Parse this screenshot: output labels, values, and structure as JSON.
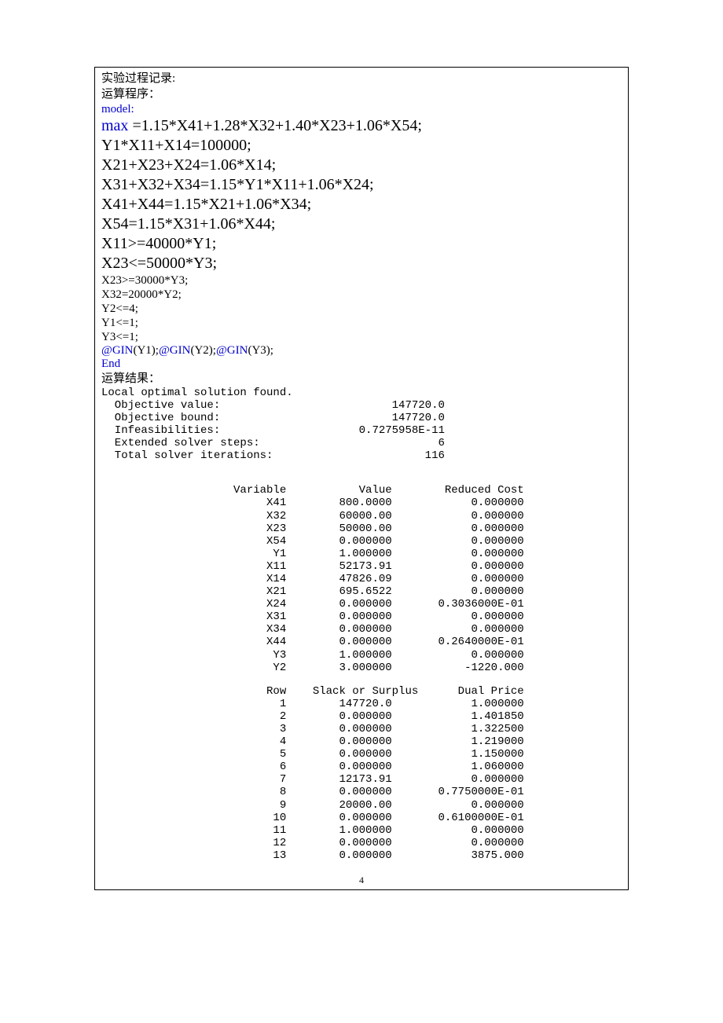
{
  "header": {
    "title": "实验过程记录:",
    "subtitle": "运算程序：",
    "model_kw": "model:"
  },
  "equations": {
    "max_label": "max",
    "max_rest": " =1.15*X41+1.28*X32+1.40*X23+1.06*X54;",
    "eq1": "Y1*X11+X14=100000;",
    "eq2": "X21+X23+X24=1.06*X14;",
    "eq3": "X31+X32+X34=1.15*Y1*X11+1.06*X24;",
    "eq4": "X41+X44=1.15*X21+1.06*X34;",
    "eq5": "X54=1.15*X31+1.06*X44;",
    "eq6": "X11>=40000*Y1;",
    "eq7": "X23<=50000*Y3;",
    "s1": "X23>=30000*Y3;",
    "s2": "X32=20000*Y2;",
    "s3": "Y2<=4;",
    "s4": "Y1<=1;",
    "s5": "Y3<=1;",
    "gin1": "@GIN",
    "gin1a": "(Y1);",
    "gin2": "@GIN",
    "gin2a": "(Y2);",
    "gin3": "@GIN",
    "gin3a": "(Y3);",
    "end": "End"
  },
  "results": {
    "title": "运算结果：",
    "status": "Local optimal solution found.",
    "summary": [
      {
        "label": "Objective value:",
        "value": "147720.0"
      },
      {
        "label": "Objective bound:",
        "value": "147720.0"
      },
      {
        "label": "Infeasibilities:",
        "value": "0.7275958E-11"
      },
      {
        "label": "Extended solver steps:",
        "value": "6"
      },
      {
        "label": "Total solver iterations:",
        "value": "116"
      }
    ],
    "var_header": {
      "c1": "Variable",
      "c2": "Value",
      "c3": "Reduced Cost"
    },
    "variables": [
      {
        "name": "X41",
        "value": "800.0000",
        "rc": "0.000000"
      },
      {
        "name": "X32",
        "value": "60000.00",
        "rc": "0.000000"
      },
      {
        "name": "X23",
        "value": "50000.00",
        "rc": "0.000000"
      },
      {
        "name": "X54",
        "value": "0.000000",
        "rc": "0.000000"
      },
      {
        "name": "Y1",
        "value": "1.000000",
        "rc": "0.000000"
      },
      {
        "name": "X11",
        "value": "52173.91",
        "rc": "0.000000"
      },
      {
        "name": "X14",
        "value": "47826.09",
        "rc": "0.000000"
      },
      {
        "name": "X21",
        "value": "695.6522",
        "rc": "0.000000"
      },
      {
        "name": "X24",
        "value": "0.000000",
        "rc": "0.3036000E-01"
      },
      {
        "name": "X31",
        "value": "0.000000",
        "rc": "0.000000"
      },
      {
        "name": "X34",
        "value": "0.000000",
        "rc": "0.000000"
      },
      {
        "name": "X44",
        "value": "0.000000",
        "rc": "0.2640000E-01"
      },
      {
        "name": "Y3",
        "value": "1.000000",
        "rc": "0.000000"
      },
      {
        "name": "Y2",
        "value": "3.000000",
        "rc": "-1220.000"
      }
    ],
    "row_header": {
      "c1": "Row",
      "c2": "Slack or Surplus",
      "c3": "Dual Price"
    },
    "rows": [
      {
        "row": "1",
        "slack": "147720.0",
        "dp": "1.000000"
      },
      {
        "row": "2",
        "slack": "0.000000",
        "dp": "1.401850"
      },
      {
        "row": "3",
        "slack": "0.000000",
        "dp": "1.322500"
      },
      {
        "row": "4",
        "slack": "0.000000",
        "dp": "1.219000"
      },
      {
        "row": "5",
        "slack": "0.000000",
        "dp": "1.150000"
      },
      {
        "row": "6",
        "slack": "0.000000",
        "dp": "1.060000"
      },
      {
        "row": "7",
        "slack": "12173.91",
        "dp": "0.000000"
      },
      {
        "row": "8",
        "slack": "0.000000",
        "dp": "0.7750000E-01"
      },
      {
        "row": "9",
        "slack": "20000.00",
        "dp": "0.000000"
      },
      {
        "row": "10",
        "slack": "0.000000",
        "dp": "0.6100000E-01"
      },
      {
        "row": "11",
        "slack": "1.000000",
        "dp": "0.000000"
      },
      {
        "row": "12",
        "slack": "0.000000",
        "dp": "0.000000"
      },
      {
        "row": "13",
        "slack": "0.000000",
        "dp": "3875.000"
      }
    ]
  },
  "page_number": "4"
}
